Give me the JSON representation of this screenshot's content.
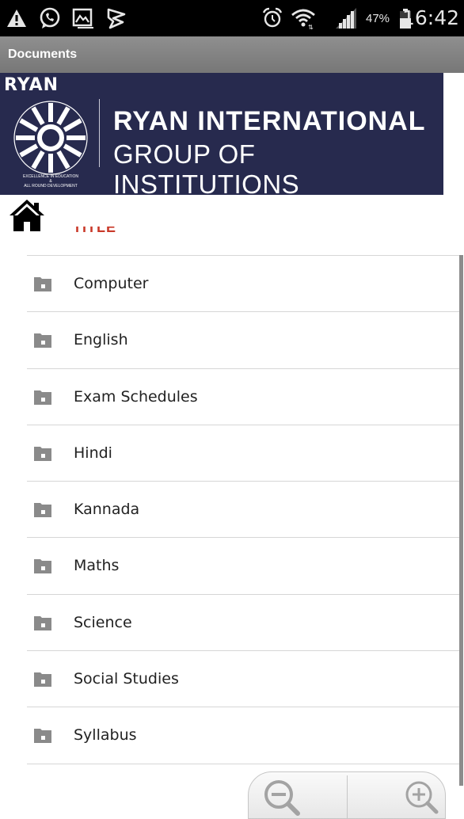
{
  "status_bar": {
    "icons": [
      "warning-icon",
      "whatsapp-icon",
      "gallery-icon",
      "flipboard-icon",
      "alarm-icon",
      "wifi-icon",
      "signal-icon",
      "battery-icon"
    ],
    "battery_percent": "47%",
    "time": "16:42"
  },
  "app_bar": {
    "title": "Documents"
  },
  "banner": {
    "logo_word": "RYAN",
    "logo_motto": [
      "EXCELLENCE IN EDUCATION",
      "&",
      "ALL ROUND DEVELOPMENT"
    ],
    "org_line1": "RYAN INTERNATIONAL",
    "org_line2": "GROUP OF INSTITUTIONS",
    "background_color": "#272a4e"
  },
  "list": {
    "header": "TITLE",
    "items": [
      {
        "label": "Computer"
      },
      {
        "label": "English"
      },
      {
        "label": "Exam Schedules"
      },
      {
        "label": "Hindi"
      },
      {
        "label": "Kannada"
      },
      {
        "label": "Maths"
      },
      {
        "label": "Science"
      },
      {
        "label": "Social Studies"
      },
      {
        "label": "Syllabus"
      }
    ]
  },
  "zoom": {
    "out_icon": "zoom-out-icon",
    "in_icon": "zoom-in-icon"
  },
  "colors": {
    "header_accent": "#c93a2a",
    "folder_icon": "#8a8a8a",
    "divider": "#d6d6d6"
  }
}
